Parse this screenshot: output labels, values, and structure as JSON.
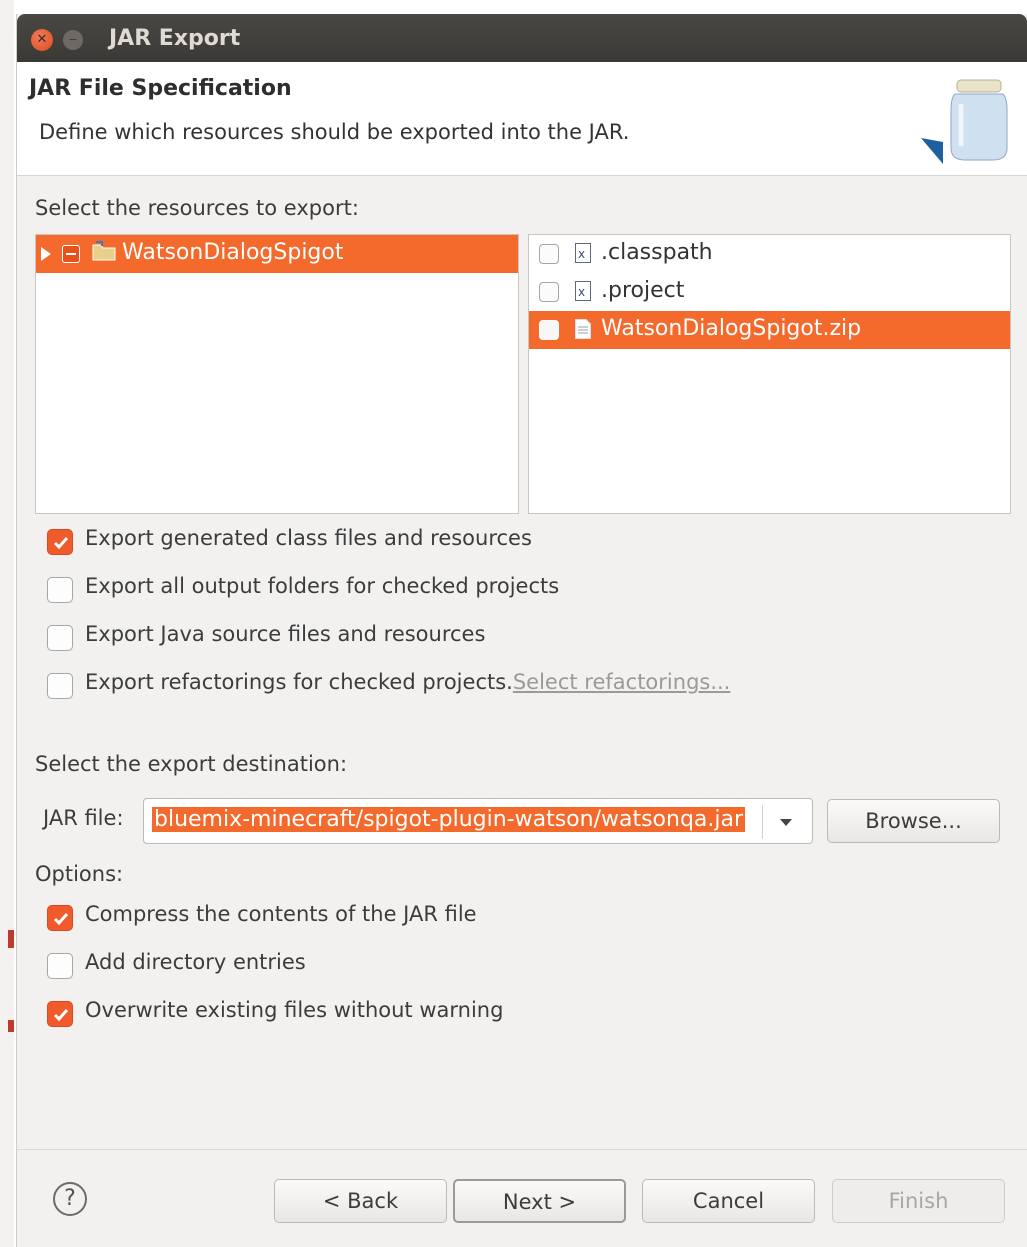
{
  "window": {
    "title": "JAR Export"
  },
  "header": {
    "title": "JAR File Specification",
    "description": "Define which resources should be exported into the JAR."
  },
  "resources": {
    "label": "Select the resources to export:",
    "tree": [
      {
        "name": "WatsonDialogSpigot",
        "selected": true,
        "check_state": "partial"
      }
    ],
    "files": [
      {
        "name": ".classpath",
        "checked": false,
        "selected": false
      },
      {
        "name": ".project",
        "checked": false,
        "selected": false
      },
      {
        "name": "WatsonDialogSpigot.zip",
        "checked": false,
        "selected": true
      }
    ]
  },
  "export_options": [
    {
      "label": "Export generated class files and resources",
      "checked": true
    },
    {
      "label": "Export all output folders for checked projects",
      "checked": false
    },
    {
      "label": "Export Java source files and resources",
      "checked": false
    },
    {
      "label": "Export refactorings for checked projects.",
      "checked": false,
      "link": "Select refactorings..."
    }
  ],
  "destination": {
    "label": "Select the export destination:",
    "jar_label": "JAR file:",
    "jar_value": "bluemix-minecraft/spigot-plugin-watson/watsonqa.jar",
    "browse_label": "Browse..."
  },
  "options": {
    "label": "Options:",
    "items": [
      {
        "label": "Compress the contents of the JAR file",
        "checked": true
      },
      {
        "label": "Add directory entries",
        "checked": false
      },
      {
        "label": "Overwrite existing files without warning",
        "checked": true
      }
    ]
  },
  "buttons": {
    "help": "?",
    "back": "< Back",
    "next": "Next >",
    "cancel": "Cancel",
    "finish": "Finish"
  },
  "colors": {
    "selection": "#f46a2c",
    "check_accent": "#ef5b2b",
    "titlebar": "#3f3d39"
  }
}
